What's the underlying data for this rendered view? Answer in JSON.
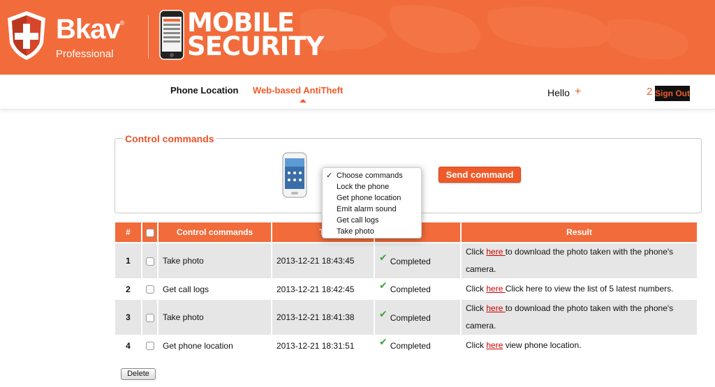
{
  "header": {
    "brand": "Bkav",
    "brand_mark": "®",
    "brand_sub": "Professional",
    "product_line1": "MOBILE",
    "product_line2": "SECURITY"
  },
  "nav": {
    "phone_location": "Phone Location",
    "antitheft": "Web-based AntiTheft",
    "hello": "Hello",
    "hello_plus": "+",
    "count": "2",
    "sign_out": "Sign Out"
  },
  "control": {
    "title": "Control commands",
    "send_label": "Send command",
    "dropdown": {
      "options": [
        "Choose commands",
        "Lock the phone",
        "Get phone location",
        "Emit alarm sound",
        "Get call logs",
        "Take photo"
      ],
      "selected_index": 0,
      "check": "✓"
    }
  },
  "table": {
    "headers": [
      "#",
      "",
      "Control commands",
      "Time",
      "Status",
      "Result"
    ],
    "header_time_visible": "Ti",
    "header_status_visible": "atus",
    "rows": [
      {
        "num": "1",
        "command": "Take photo",
        "time": "2013-12-21 18:43:45",
        "status": "Completed",
        "result_pre": "Click ",
        "link": "here ",
        "result_post": "to download the photo taken with the phone's camera."
      },
      {
        "num": "2",
        "command": "Get call logs",
        "time": "2013-12-21 18:42:45",
        "status": "Completed",
        "result_pre": "Click ",
        "link": "here ",
        "result_post": "Click here to view the list of 5 latest numbers."
      },
      {
        "num": "3",
        "command": "Take photo",
        "time": "2013-12-21 18:41:38",
        "status": "Completed",
        "result_pre": "Click ",
        "link": "here ",
        "result_post": "to download the photo taken with the phone's camera."
      },
      {
        "num": "4",
        "command": "Get phone location",
        "time": "2013-12-21 18:31:51",
        "status": "Completed",
        "result_pre": "Click ",
        "link": "here",
        "result_post": " view phone location."
      }
    ],
    "delete_label": "Delete"
  },
  "colors": {
    "accent": "#f26b3a",
    "link": "#cc0000",
    "success": "#3fa33f"
  }
}
